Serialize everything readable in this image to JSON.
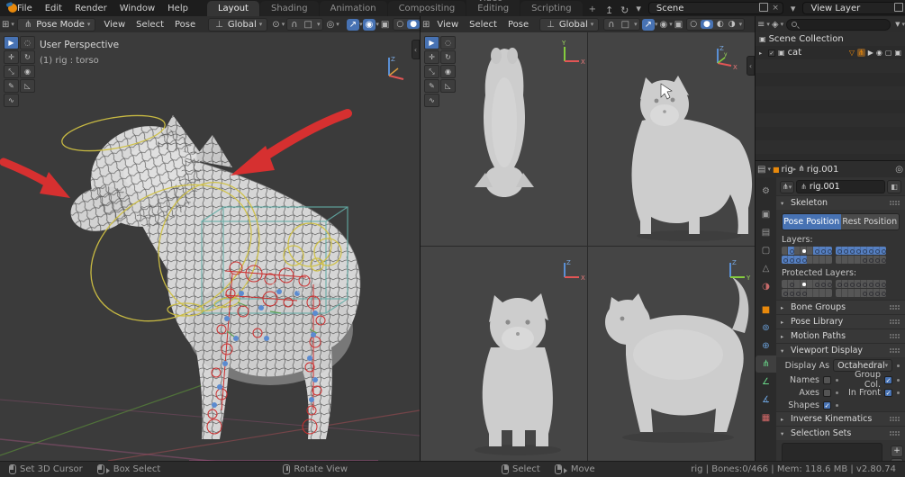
{
  "topbar": {
    "menus": [
      {
        "label": "File"
      },
      {
        "label": "Edit"
      },
      {
        "label": "Render"
      },
      {
        "label": "Window"
      },
      {
        "label": "Help"
      }
    ],
    "tabs": [
      {
        "label": "Layout",
        "active": true
      },
      {
        "label": "Shading",
        "active": false
      },
      {
        "label": "Animation",
        "active": false
      },
      {
        "label": "Compositing",
        "active": false
      },
      {
        "label": "Video Editing",
        "active": false
      },
      {
        "label": "Scripting",
        "active": false
      }
    ],
    "add_tab": "+",
    "scene": {
      "value": "Scene"
    },
    "view_layer": {
      "value": "View Layer"
    }
  },
  "viewport1_header": {
    "mode": "Pose Mode",
    "menus": [
      "View",
      "Select",
      "Pose"
    ],
    "orientation": "Global"
  },
  "viewport2_header": {
    "menus": [
      "View",
      "Select",
      "Pose"
    ],
    "orientation": "Global"
  },
  "viewport_overlay": {
    "line1": "User Perspective",
    "line2": "(1) rig : torso"
  },
  "outliner": {
    "root_label": "Scene Collection",
    "item_label": "cat"
  },
  "properties": {
    "breadcrumb": {
      "object": "rig",
      "data": "rig.001"
    },
    "id_name": "rig.001",
    "skeleton": {
      "label": "Skeleton",
      "pose_position": "Pose Position",
      "rest_position": "Rest Position",
      "layers_label": "Layers:",
      "protected_label": "Protected Layers:",
      "layers_a": [
        [
          "E",
          "B",
          "E",
          "A",
          "E",
          "B",
          "B",
          "B"
        ],
        [
          "B",
          "B",
          "B",
          "B",
          "E",
          "E",
          "E",
          "E"
        ]
      ],
      "layers_b": [
        [
          "B",
          "B",
          "B",
          "B",
          "B",
          "B",
          "B",
          "B"
        ],
        [
          "E",
          "E",
          "E",
          "E",
          "D",
          "D",
          "D",
          "D"
        ]
      ],
      "protected_a": [
        [
          "E",
          "D",
          "E",
          "A",
          "E",
          "D",
          "D",
          "D"
        ],
        [
          "D",
          "D",
          "D",
          "D",
          "E",
          "E",
          "E",
          "E"
        ]
      ],
      "protected_b": [
        [
          "D",
          "D",
          "D",
          "D",
          "D",
          "D",
          "D",
          "D"
        ],
        [
          "E",
          "E",
          "E",
          "E",
          "D",
          "D",
          "D",
          "D"
        ]
      ]
    },
    "bone_groups": "Bone Groups",
    "pose_library": "Pose Library",
    "motion_paths": "Motion Paths",
    "viewport_display": {
      "label": "Viewport Display",
      "display_as_label": "Display As",
      "display_as_value": "Octahedral",
      "checkboxes": [
        {
          "label": "Names",
          "checked": false
        },
        {
          "label": "Group Col.",
          "checked": true
        },
        {
          "label": "Axes",
          "checked": false
        },
        {
          "label": "In Front",
          "checked": true
        },
        {
          "label": "Shapes",
          "checked": true
        }
      ]
    },
    "inverse_kinematics": "Inverse Kinematics",
    "selection_sets": "Selection Sets",
    "add_button": "+"
  },
  "status_bar": {
    "hints": [
      {
        "button": "left",
        "label": "Set 3D Cursor"
      },
      {
        "button": "left-drag",
        "label": "Box Select"
      },
      {
        "button": "middle",
        "label": "Rotate View"
      },
      {
        "button": "right",
        "label": "Select"
      },
      {
        "button": "right-drag",
        "label": "Move"
      }
    ],
    "info": "rig | Bones:0/466  | Mem: 118.6 MB | v2.80.74"
  },
  "icons": {
    "chevron_down": "▾",
    "disclosure_closed": "▸",
    "disclosure_open": "▾",
    "editor_viewport": "⊞",
    "editor_outliner": "≡",
    "editor_properties": "▤",
    "display_mode": "◈",
    "mode_pose": "⋔",
    "orientation": "⊥",
    "pivot": "⊙",
    "magnet": "∩",
    "snap_target": "□",
    "proportional": "◎",
    "gizmo_arrow": "↗",
    "overlays": "◉",
    "xray": "▣",
    "sphere_wire": "○",
    "sphere_solid": "●",
    "sphere_material": "◐",
    "sphere_rendered": "◑",
    "close": "×",
    "publish": "↥",
    "sync": "↻",
    "filter": "▼",
    "collection": "▣",
    "mesh": "▽",
    "armature": "⋔",
    "select_arrow": "▶",
    "eye": "◉",
    "screen": "▢",
    "camera": "▣",
    "object_square": "■",
    "pin": "◎",
    "shield": "◧",
    "collapse": "‹",
    "tabs": [
      "⚙",
      "▣",
      "▤",
      "▢",
      "△",
      "◑",
      "■",
      "⊚",
      "⊕",
      "⋔",
      "∠",
      "∡",
      "▦"
    ],
    "tools": [
      "▶",
      "◌",
      "✛",
      "↻",
      "⤡",
      "◉",
      "✎",
      "◺",
      "∿"
    ]
  }
}
